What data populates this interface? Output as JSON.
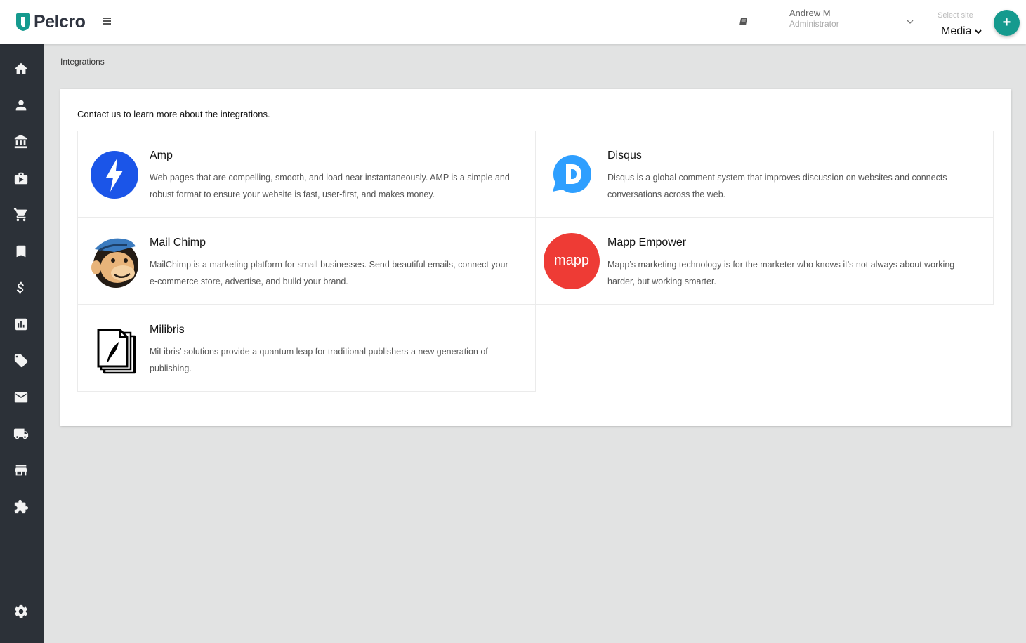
{
  "header": {
    "brand": "Pelcro",
    "user_name": "Andrew M",
    "user_role": "Administrator",
    "site_label": "Select site",
    "site_value": "Media",
    "add_label": "+"
  },
  "sidebar": {
    "items": [
      {
        "icon": "home-icon"
      },
      {
        "icon": "person-icon"
      },
      {
        "icon": "bank-icon"
      },
      {
        "icon": "subscriptions-icon"
      },
      {
        "icon": "cart-icon"
      },
      {
        "icon": "bookmark-icon"
      },
      {
        "icon": "dollar-icon"
      },
      {
        "icon": "chart-icon"
      },
      {
        "icon": "coupon-icon"
      },
      {
        "icon": "mail-icon"
      },
      {
        "icon": "truck-icon"
      },
      {
        "icon": "store-icon"
      },
      {
        "icon": "puzzle-icon"
      },
      {
        "icon": "gear-icon"
      }
    ]
  },
  "breadcrumb": "Integrations",
  "intro": "Contact us to learn more about the integrations.",
  "integrations": [
    {
      "title": "Amp",
      "description": "Web pages that are compelling, smooth, and load near instantaneously. AMP is a simple and robust format to ensure your website is fast, user-first, and makes money."
    },
    {
      "title": "Disqus",
      "description": "Disqus is a global comment system that improves discussion on websites and connects conversations across the web."
    },
    {
      "title": "Mail Chimp",
      "description": "MailChimp is a marketing platform for small businesses. Send beautiful emails, connect your e-commerce store, advertise, and build your brand."
    },
    {
      "title": "Mapp Empower",
      "logo_text": "mapp",
      "description": "Mapp’s marketing technology is for the marketer who knows it’s not always about working harder, but working smarter."
    },
    {
      "title": "Milibris",
      "description": "MiLibris’ solutions provide a quantum leap for traditional publishers a new generation of publishing."
    }
  ],
  "colors": {
    "sidebar": "#2c3138",
    "accent": "#159a8e",
    "amp": "#1b55e8",
    "disqus": "#2e9fff",
    "mapp": "#ee3b35"
  }
}
